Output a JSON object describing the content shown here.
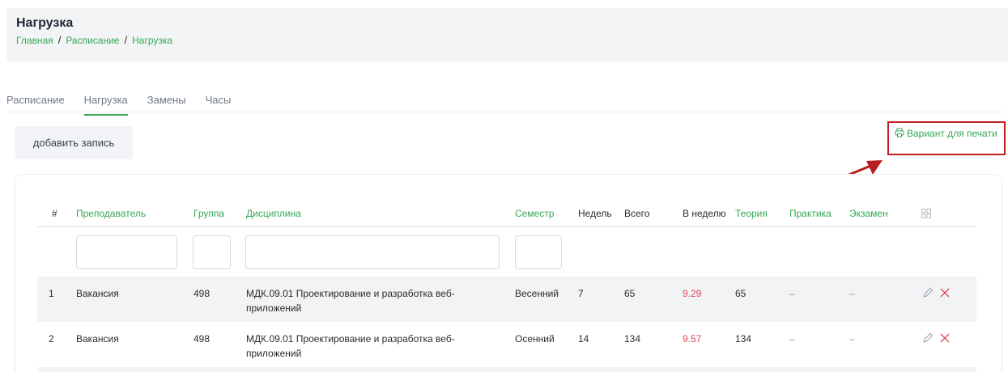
{
  "header": {
    "title": "Нагрузка",
    "breadcrumb": [
      "Главная",
      "Расписание",
      "Нагрузка"
    ],
    "separator": "/"
  },
  "tabs": [
    {
      "label": "Расписание",
      "active": false
    },
    {
      "label": "Нагрузка",
      "active": true
    },
    {
      "label": "Замены",
      "active": false
    },
    {
      "label": "Часы",
      "active": false
    }
  ],
  "toolbar": {
    "add_label": "добавить запись",
    "print_label": "Вариант для печати",
    "print_icon": "printer-icon"
  },
  "table": {
    "columns": [
      "#",
      "Преподаватель",
      "Группа",
      "Дисциплина",
      "Семестр",
      "Недель",
      "Всего",
      "В неделю",
      "Теория",
      "Практика",
      "Экзамен"
    ],
    "settings_icon": "grid-icon",
    "rows": [
      {
        "num": "1",
        "teacher": "Вакансия",
        "group": "498",
        "discipline": "МДК.09.01 Проектирование и разработка веб-приложений",
        "semester": "Весенний",
        "weeks": "7",
        "total": "65",
        "per_week": "9.29",
        "theory": "65",
        "practice": "–",
        "exam": "–"
      },
      {
        "num": "2",
        "teacher": "Вакансия",
        "group": "498",
        "discipline": "МДК.09.01 Проектирование и разработка веб-приложений",
        "semester": "Осенний",
        "weeks": "14",
        "total": "134",
        "per_week": "9.57",
        "theory": "134",
        "practice": "–",
        "exam": "–"
      }
    ]
  },
  "colors": {
    "accent": "#34a853",
    "highlight": "#e0455d",
    "annotation": "#c0201f"
  }
}
